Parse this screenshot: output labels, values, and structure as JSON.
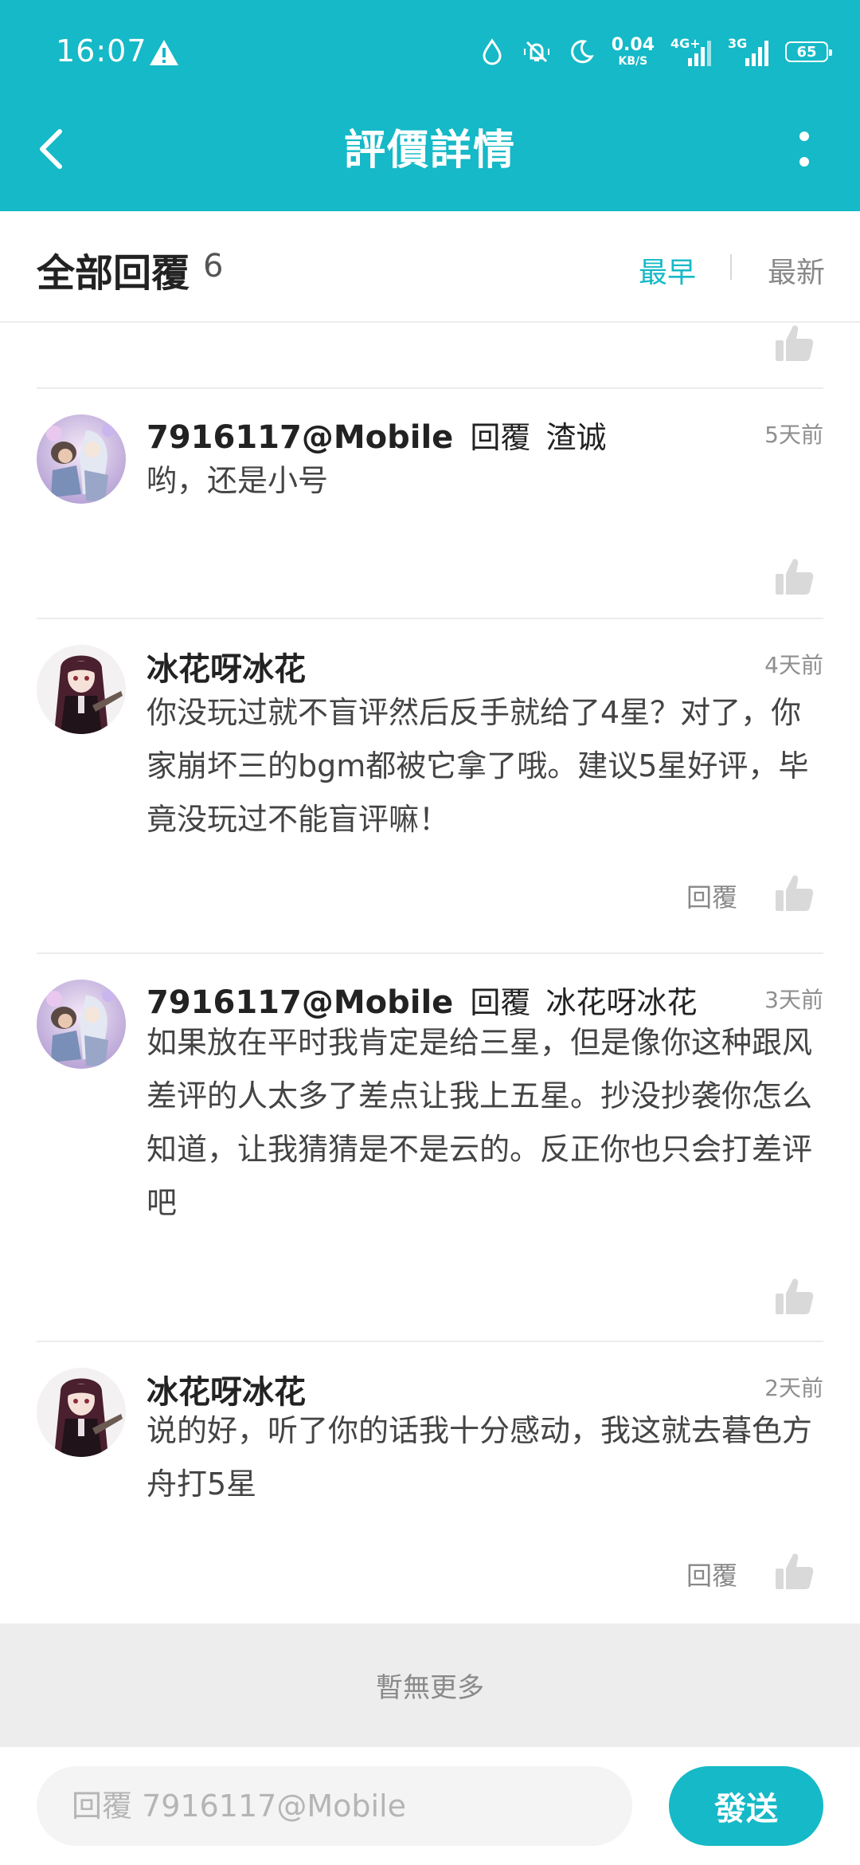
{
  "status_bar": {
    "time": "16:07",
    "net_speed_value": "0.04",
    "net_speed_unit": "KB/S",
    "net1_label": "4G+",
    "net2_label": "3G",
    "battery": "65"
  },
  "header": {
    "title": "評價詳情"
  },
  "replies_header": {
    "title": "全部回覆",
    "count": "6",
    "sort_earliest": "最早",
    "sort_latest": "最新",
    "active_sort": "最早"
  },
  "comments": [
    {
      "user": "7916117@Mobile",
      "verb": "回覆",
      "target": "渣诚",
      "time": "5天前",
      "text": "哟，还是小号"
    },
    {
      "user": "冰花呀冰花",
      "time": "4天前",
      "text": "你没玩过就不盲评然后反手就给了4星？对了，你家崩坏三的bgm都被它拿了哦。建议5星好评，毕竟没玩过不能盲评嘛！",
      "reply_label": "回覆"
    },
    {
      "user": "7916117@Mobile",
      "verb": "回覆",
      "target": "冰花呀冰花",
      "time": "3天前",
      "text": "如果放在平时我肯定是给三星，但是像你这种跟风差评的人太多了差点让我上五星。抄没抄袭你怎么知道，让我猜猜是不是云的。反正你也只会打差评吧"
    },
    {
      "user": "冰花呀冰花",
      "time": "2天前",
      "text": "说的好，听了你的话我十分感动，我这就去暮色方舟打5星",
      "reply_label": "回覆"
    }
  ],
  "footer": {
    "no_more": "暫無更多"
  },
  "input": {
    "placeholder": "回覆 7916117@Mobile",
    "send_label": "發送"
  },
  "colors": {
    "accent": "#15b9c7",
    "divider": "#ececec",
    "footer_bg": "#ededed"
  }
}
